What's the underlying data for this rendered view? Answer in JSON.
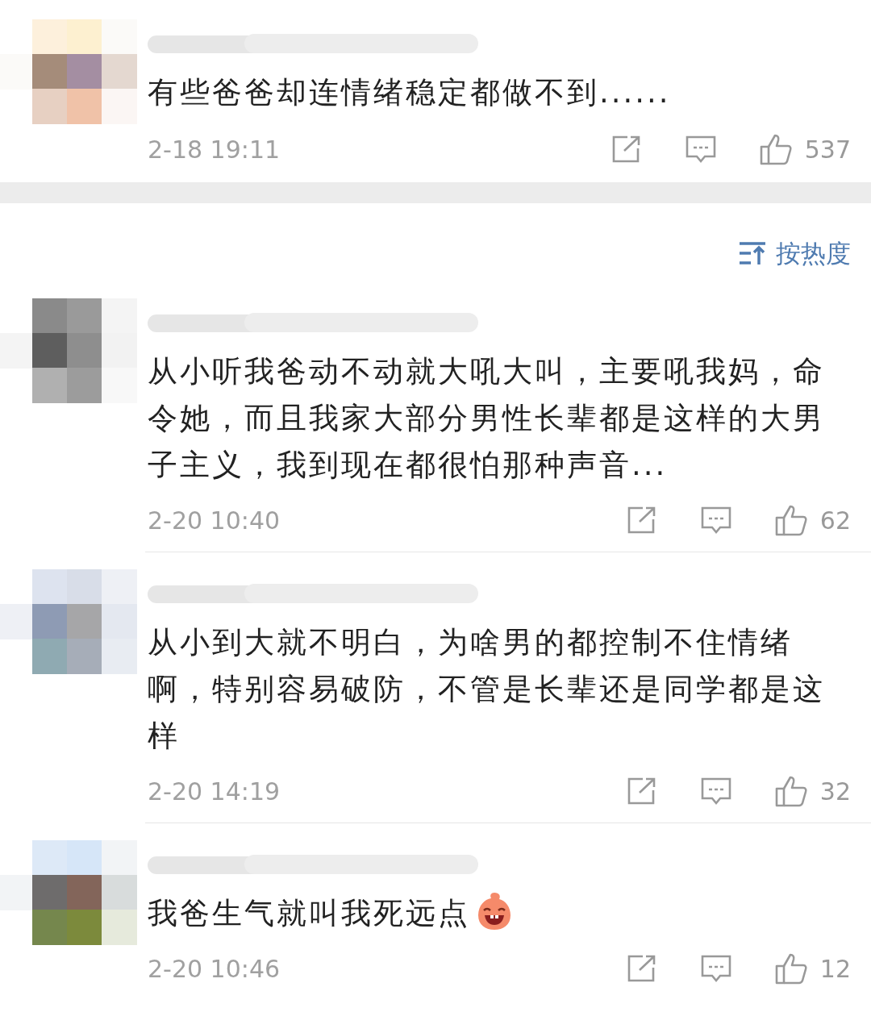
{
  "top_comment": {
    "text": "有些爸爸却连情绪稳定都做不到......",
    "time": "2-18 19:11",
    "likes": "537",
    "has_emoji": false
  },
  "sort": {
    "label": "按热度"
  },
  "comments": [
    {
      "text": "从小听我爸动不动就大吼大叫，主要吼我妈，命令她，而且我家大部分男性长辈都是这样的大男子主义，我到现在都很怕那种声音...",
      "time": "2-20 10:40",
      "likes": "62",
      "has_emoji": false
    },
    {
      "text": "从小到大就不明白，为啥男的都控制不住情绪啊，特别容易破防，不管是长辈还是同学都是这样",
      "time": "2-20 14:19",
      "likes": "32",
      "has_emoji": false
    },
    {
      "text": "我爸生气就叫我死远点",
      "time": "2-20 10:46",
      "likes": "12",
      "has_emoji": true
    }
  ]
}
